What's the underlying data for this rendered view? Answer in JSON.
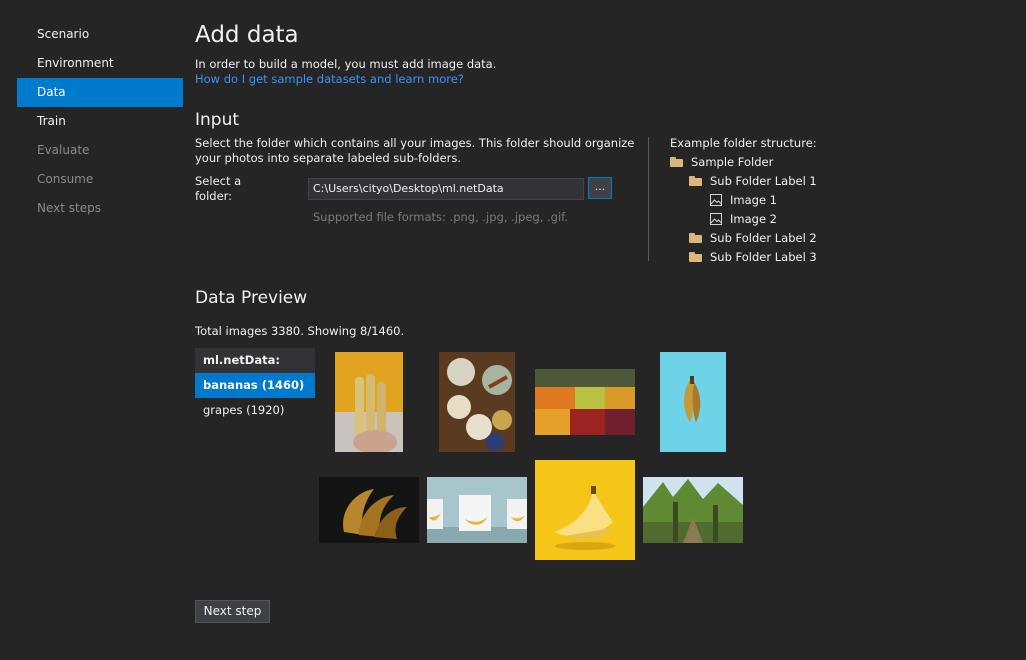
{
  "nav": {
    "items": [
      {
        "label": "Scenario"
      },
      {
        "label": "Environment"
      },
      {
        "label": "Data"
      },
      {
        "label": "Train"
      },
      {
        "label": "Evaluate"
      },
      {
        "label": "Consume"
      },
      {
        "label": "Next steps"
      }
    ]
  },
  "page": {
    "title": "Add data",
    "intro": "In order to build a model, you must add image data.",
    "link": "How do I get sample datasets and learn more?"
  },
  "input": {
    "heading": "Input",
    "description": "Select the folder which contains all your images. This folder should organize your photos into separate labeled sub-folders.",
    "select_label": "Select a folder:",
    "path_value": "C:\\Users\\cityo\\Desktop\\ml.netData",
    "browse_label": "...",
    "formats": "Supported file formats: .png, .jpg, .jpeg, .gif."
  },
  "example": {
    "title": "Example folder structure:",
    "root": "Sample Folder",
    "sub1": "Sub Folder Label 1",
    "image1": "Image 1",
    "image2": "Image 2",
    "sub2": "Sub Folder Label 2",
    "sub3": "Sub Folder Label 3"
  },
  "preview": {
    "heading": "Data Preview",
    "total": "Total images 3380. Showing 8/1460.",
    "list": {
      "header": "ml.netData:",
      "items": [
        {
          "label": "bananas (1460)"
        },
        {
          "label": "grapes (1920)"
        }
      ]
    }
  },
  "footer": {
    "next_label": "Next step"
  },
  "colors": {
    "background": "#252526",
    "accent": "#007acc",
    "link": "#3794ff",
    "folder": "#dcb67a"
  }
}
